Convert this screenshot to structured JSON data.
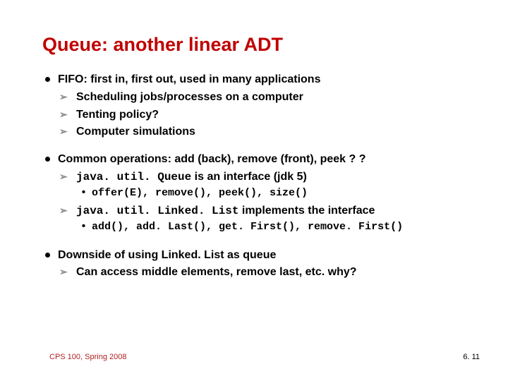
{
  "title": "Queue: another linear ADT",
  "b1": {
    "text": "FIFO: first in, first out, used in many applications",
    "s1": "Scheduling jobs/processes on a computer",
    "s2": "Tenting policy?",
    "s3": "Computer simulations"
  },
  "b2": {
    "text": "Common operations: add (back), remove (front), peek ? ?",
    "s1_pre": "java. util. Queue",
    "s1_post": " is an interface (jdk 5)",
    "s1s1": "offer(E), remove(), peek(), size()",
    "s2_pre": "java. util. Linked. List",
    "s2_post": " implements the interface",
    "s2s1": "add(), add. Last(), get. First(), remove. First()"
  },
  "b3": {
    "text": "Downside of using Linked. List as queue",
    "s1": "Can access middle elements, remove last, etc. why?"
  },
  "footer_left": "CPS 100, Spring 2008",
  "footer_right": "6. 11"
}
